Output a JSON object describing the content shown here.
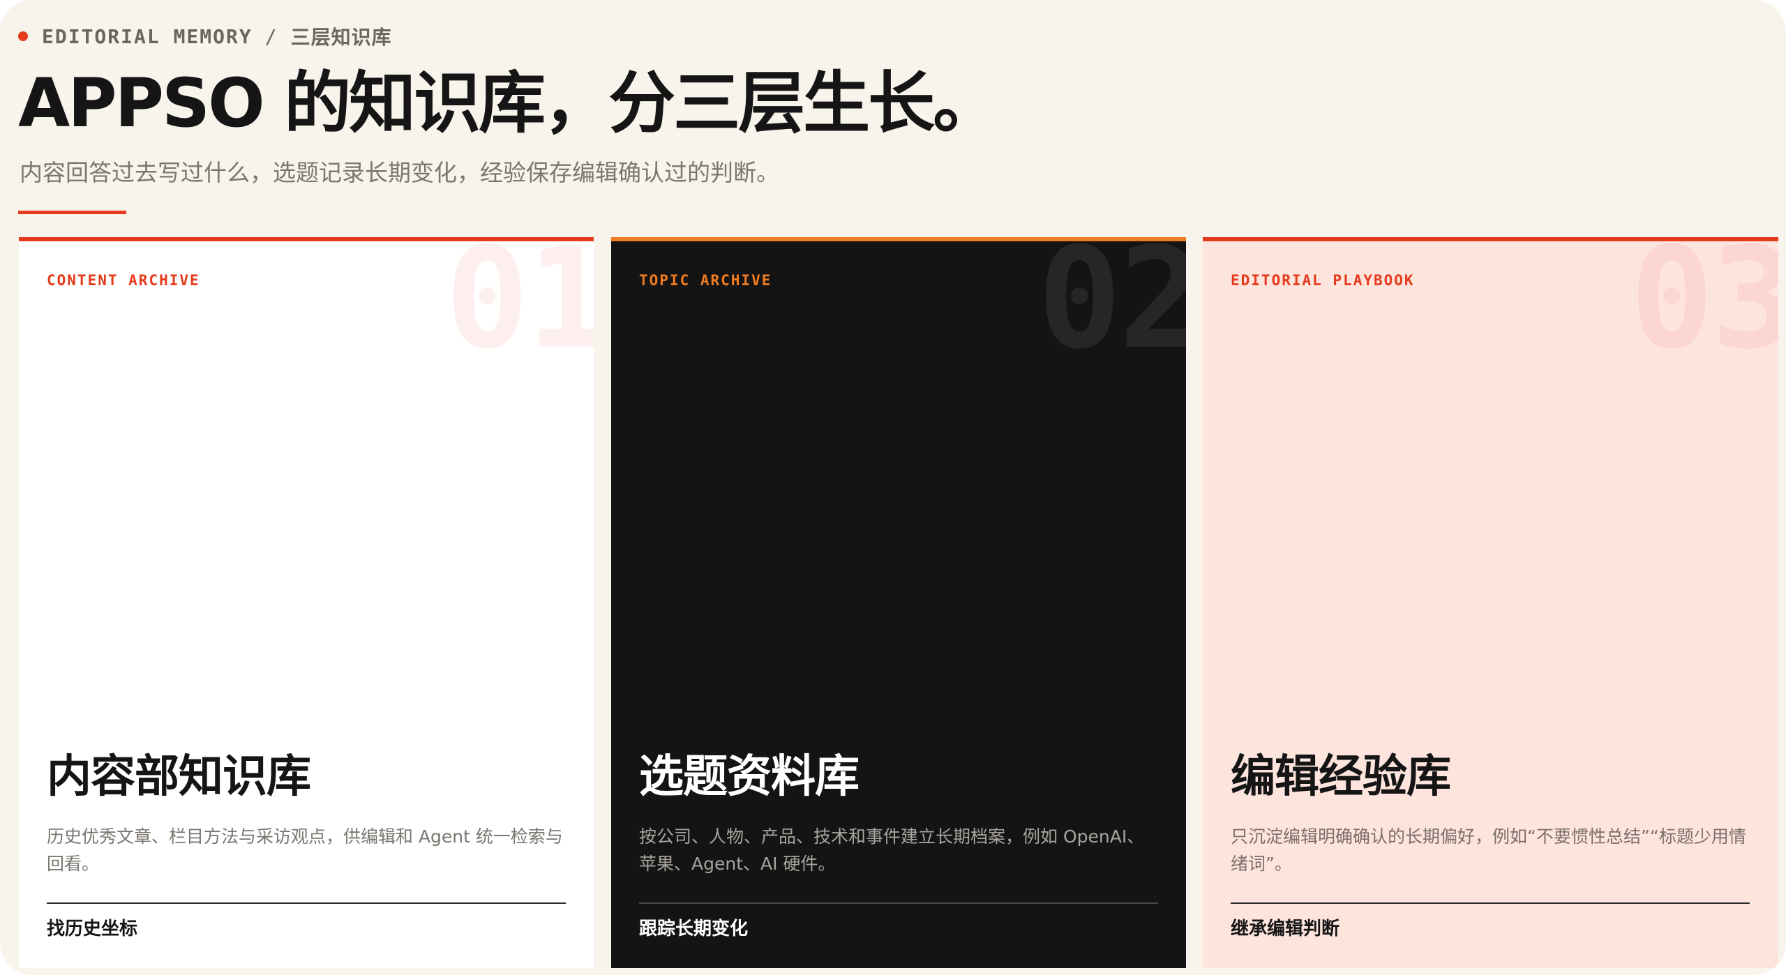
{
  "header": {
    "eyebrow_en": "EDITORIAL MEMORY",
    "eyebrow_sep": "/",
    "eyebrow_zh": "三层知识库",
    "title": "APPSO 的知识库，分三层生长。",
    "subtitle": "内容回答过去写过什么，选题记录长期变化，经验保存编辑确认过的判断。"
  },
  "colors": {
    "accent_red": "#e63a1c",
    "accent_orange": "#f07c22",
    "page_bg": "#f8f4ec",
    "card_dark": "#141414",
    "card_pink": "#fde4dd"
  },
  "cards": [
    {
      "number": "01",
      "kicker": "CONTENT ARCHIVE",
      "title": "内容部知识库",
      "description": "历史优秀文章、栏目方法与采访观点，供编辑和 Agent 统一检索与回看。",
      "link": "找历史坐标"
    },
    {
      "number": "02",
      "kicker": "TOPIC ARCHIVE",
      "title": "选题资料库",
      "description": "按公司、人物、产品、技术和事件建立长期档案，例如 OpenAI、苹果、Agent、AI 硬件。",
      "link": "跟踪长期变化"
    },
    {
      "number": "03",
      "kicker": "EDITORIAL PLAYBOOK",
      "title": "编辑经验库",
      "description": "只沉淀编辑明确确认的长期偏好，例如“不要惯性总结”“标题少用情绪词”。",
      "link": "继承编辑判断"
    }
  ]
}
